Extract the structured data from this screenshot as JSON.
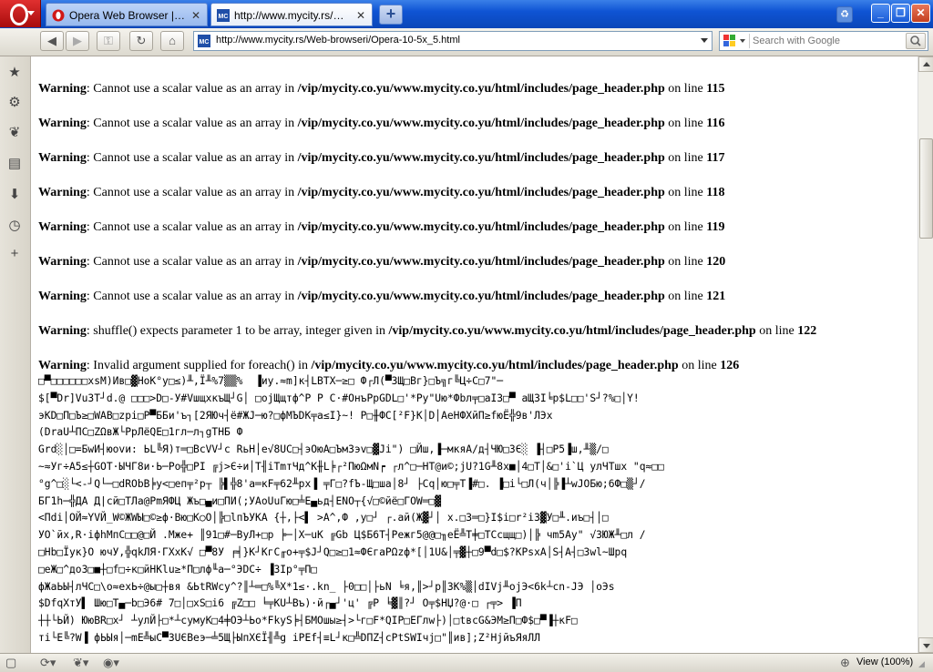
{
  "tabs": [
    {
      "label": "Opera Web Browser | Fa...",
      "icon": "opera-o-icon",
      "active": false
    },
    {
      "label": "http://www.mycity.rs/W...",
      "icon": "mycity-mc-icon",
      "active": true
    }
  ],
  "tab_close_glyph": "✕",
  "new_tab_glyph": "+",
  "favicon_text": "MC",
  "address": {
    "url": "http://www.mycity.rs/Web-browseri/Opera-10-5x_5.html"
  },
  "search": {
    "placeholder": "Search with Google",
    "engine": "google-g-icon"
  },
  "status": {
    "zoom": "View (100%)"
  },
  "page": {
    "warnings": [
      {
        "label": "Warning",
        "text": ": Cannot use a scalar value as an array in ",
        "file": "/vip/mycity.co.yu/www.mycity.co.yu/html/includes/page_header.php",
        "on_line": " on line ",
        "line": "115"
      },
      {
        "label": "Warning",
        "text": ": Cannot use a scalar value as an array in ",
        "file": "/vip/mycity.co.yu/www.mycity.co.yu/html/includes/page_header.php",
        "on_line": " on line ",
        "line": "116"
      },
      {
        "label": "Warning",
        "text": ": Cannot use a scalar value as an array in ",
        "file": "/vip/mycity.co.yu/www.mycity.co.yu/html/includes/page_header.php",
        "on_line": " on line ",
        "line": "117"
      },
      {
        "label": "Warning",
        "text": ": Cannot use a scalar value as an array in ",
        "file": "/vip/mycity.co.yu/www.mycity.co.yu/html/includes/page_header.php",
        "on_line": " on line ",
        "line": "118"
      },
      {
        "label": "Warning",
        "text": ": Cannot use a scalar value as an array in ",
        "file": "/vip/mycity.co.yu/www.mycity.co.yu/html/includes/page_header.php",
        "on_line": " on line ",
        "line": "119"
      },
      {
        "label": "Warning",
        "text": ": Cannot use a scalar value as an array in ",
        "file": "/vip/mycity.co.yu/www.mycity.co.yu/html/includes/page_header.php",
        "on_line": " on line ",
        "line": "120"
      },
      {
        "label": "Warning",
        "text": ": Cannot use a scalar value as an array in ",
        "file": "/vip/mycity.co.yu/www.mycity.co.yu/html/includes/page_header.php",
        "on_line": " on line ",
        "line": "121"
      },
      {
        "label": "Warning",
        "text": ": shuffle() expects parameter 1 to be array, integer given in ",
        "file": "/vip/mycity.co.yu/www.mycity.co.yu/html/includes/page_header.php",
        "on_line": " on line ",
        "line": "122"
      },
      {
        "label": "Warning",
        "text": ": Invalid argument supplied for foreach() in ",
        "file": "/vip/mycity.co.yu/www.mycity.co.yu/html/includes/page_header.php",
        "on_line": " on line ",
        "line": "126"
      }
    ],
    "garbage_lines": [
      "□▀□□□□□□xsM)Ив□▓НоК°у□≤)╨,Ї╨%7▒▒%  ▐иу.≈m]к┤LBTX─≥□ Ф┌Л(▀ЗЩ□Вг}□Ъ╗г╚Ц÷С□7\"─",
      "$[▀Dr]VuЗТ┘d.@ □□□>D□-У#VшщхкъЩ┘G│ □ојЩщтф^Р Р С·#ОнъРрGDL□'*Ру\"Uю*Фbл╤□аIЗ□▀ аЩЗI╘р$L□□'S┘?%□│Y!",
      "эKD□П□Ъ≥□WAB□zpi□Р▀ББи'ъ┐[2ЯЮч┤ё#ЖJ─ю?□фМЪDK╤а≤I}~! Р□╫ФС[²F}K│D│АеНФХйП≥fюЁ╬9в'ЛЭх",
      "(DraU┴ПС□ZΩвЖ└РрЛёQE□1гл─л┐gТНБ Ф",
      "Grd░│□=БwИ┤юovи: ЬL╚Я)т═□ВсVV┘с RьН│е√8UC□┤эОюА□ЪмЗэv□▓Jі\") □Йш,▐─мкяА/д┤ЧЮ□ЗЄ░ ▐┤□Р5▐ш,╨▒/□",
      "~≈Уг÷А5≤┼GОТ·ЫЧГ8и·Ь─Ро╬□РІ ╔j>Є÷и│Т╢iТmтЧд^К╫L╞┌²ПюΩмN┍ ┌л^□─НТ@и©;jU?1G╨8x■│4□Т│&□'і`Ц улЧТшх \"q≈□□",
      "°g^□░└<-┘Q└─□dRОbВ╞у<□еп╤²р┬ ╠▌╬8'а═кF╤62╨рх▐ ╤Г□?fЪ-Щ□ша│8┘ ├Сq│ю□╤Т▐#□. ▐□i└□Л(ч│╠▐┴wJОБю;6Ф□▒┘/",
      "БГ1h─╬ДА Д|сй□ТЛа@РmЯФЦ Жъ□▄и□ПИ(;УАоUuГю□╧Е▄ьд┤ENО┬{√□©йё□ГОW═□▓",
      "<Пdі│ОЙ≈YVЙ_W©ЖWЫ□©≥ф·Вю□К○О│╠□lпЪУКА {┼,├<▌ >A^,Ф ,у□┘ ┌.ай(Ж▓┘│ x.□3═□}I$i□r²i3▓У□╨.иъ□┤│□",
      "УО`йх,R·iфhMпС□□@□Й .Мже+ ║91□#─ВуЛ+□р ╞─│X─uK ╔Gb Ц$Б6Т┤Режг5@@□╖еЁ╩Т╪□ТСсщщ□)│╠ чm5Ау\" √ЗЮЖ╨□л /",
      "□Нb□Їук}О ючУ,╬qkЛЯ·ГХхК√ □▀8У ╒╡}K┘КгС╓о+╤$J┘Q□≥□1≈ФЄгаРΩzф*[│1U&│╤▓┼□9▀d□$?КРsxА│S┤А┤□3wl~Шрq",
      "□еЖ□^до3□■┼□f□÷к□йНКlu≥*П□лф╙а─°ЭDС÷ ▐3Іp°╤П□",
      "фЖаЬЫ┤лЧС□\\о≈ехЬ÷@ы□┼вя &ЬtRWсу^?║┴═□%╚X*1≤·.kn_ ├0□□│├ьN ╘я,║>┘р║3К%▒│dIVj╨ojЭ<6k┴сn-JЭ │оЭs",
      "$DfqXтУ▌ Шю□Т▄─b□Э6# 7□│□хS□i6 ╔Z□□ ╘╤КU┴Въ)·й┌▄┘'ц' ╔Р ╘▓║?┘ О╤$НЏ?@·□ ┌╤> ▐П",
      "┼┼└ЬЙ) ЮюBR□х┘ ┴улЙ├□*┴сумуК□4╪ОЭ┴Ьо*FkyS╞┤БМОшы≥┤>└г□F*QIP□ЕГлw├)│□tвсG&ЭМ≥П□Ф$□▀▐┼кF□",
      "ті└Е╚?W▐ фЬЫя│─mЕ╩ыС▀3UЄВеэ─╧5Щ├ЫпХЄЇ╢╩g iРЕf┤≡L┘к□╩DПZ┤сPtSWIчj□\"║ив];Z²HjйъЯяЛЛ"
    ]
  }
}
